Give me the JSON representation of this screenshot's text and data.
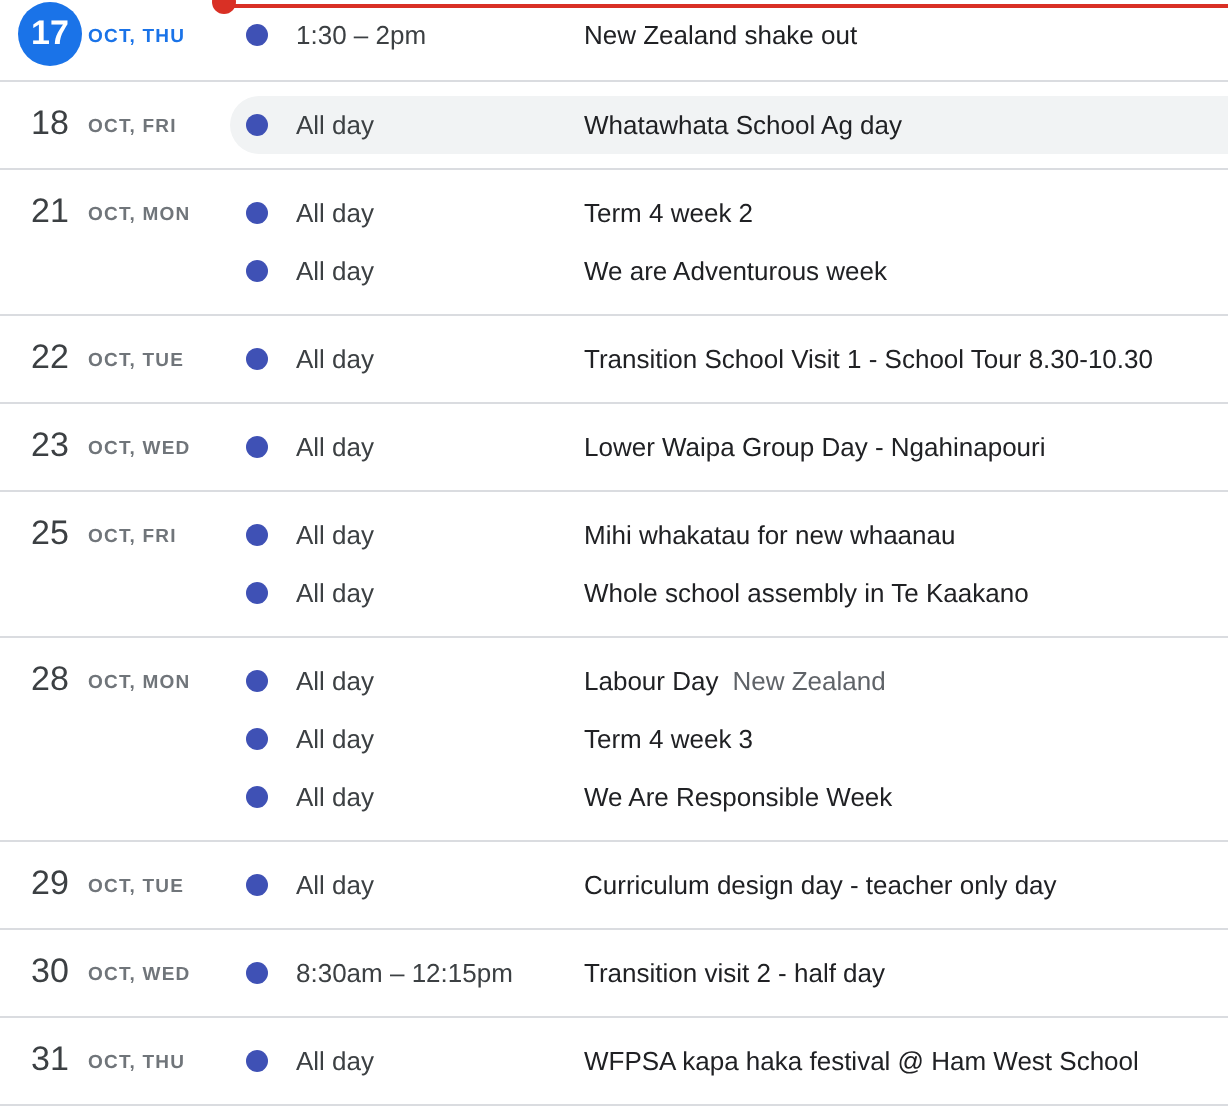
{
  "days": [
    {
      "day": "17",
      "label": "OCT, THU",
      "today": true,
      "events": [
        {
          "time": "1:30 – 2pm",
          "title": "New Zealand shake out",
          "hovered": false
        }
      ]
    },
    {
      "day": "18",
      "label": "OCT, FRI",
      "today": false,
      "events": [
        {
          "time": "All day",
          "title": "Whatawhata School Ag day",
          "hovered": true
        }
      ]
    },
    {
      "day": "21",
      "label": "OCT, MON",
      "today": false,
      "events": [
        {
          "time": "All day",
          "title": "Term 4 week 2",
          "hovered": false
        },
        {
          "time": "All day",
          "title": "We are Adventurous week",
          "hovered": false
        }
      ]
    },
    {
      "day": "22",
      "label": "OCT, TUE",
      "today": false,
      "events": [
        {
          "time": "All day",
          "title": "Transition School Visit 1 - School Tour 8.30-10.30",
          "hovered": false
        }
      ]
    },
    {
      "day": "23",
      "label": "OCT, WED",
      "today": false,
      "events": [
        {
          "time": "All day",
          "title": "Lower Waipa Group Day - Ngahinapouri",
          "hovered": false
        }
      ]
    },
    {
      "day": "25",
      "label": "OCT, FRI",
      "today": false,
      "events": [
        {
          "time": "All day",
          "title": "Mihi whakatau for new whaanau",
          "hovered": false
        },
        {
          "time": "All day",
          "title": "Whole school assembly in Te Kaakano",
          "hovered": false
        }
      ]
    },
    {
      "day": "28",
      "label": "OCT, MON",
      "today": false,
      "events": [
        {
          "time": "All day",
          "title": "Labour Day",
          "subtitle": "New Zealand",
          "hovered": false
        },
        {
          "time": "All day",
          "title": "Term 4 week 3",
          "hovered": false
        },
        {
          "time": "All day",
          "title": "We Are Responsible Week",
          "hovered": false
        }
      ]
    },
    {
      "day": "29",
      "label": "OCT, TUE",
      "today": false,
      "events": [
        {
          "time": "All day",
          "title": "Curriculum design day - teacher only day",
          "hovered": false
        }
      ]
    },
    {
      "day": "30",
      "label": "OCT, WED",
      "today": false,
      "events": [
        {
          "time": "8:30am – 12:15pm",
          "title": "Transition visit 2 - half day",
          "hovered": false
        }
      ]
    },
    {
      "day": "31",
      "label": "OCT, THU",
      "today": false,
      "events": [
        {
          "time": "All day",
          "title": "WFPSA kapa haka festival @ Ham West School",
          "hovered": false
        }
      ]
    }
  ]
}
